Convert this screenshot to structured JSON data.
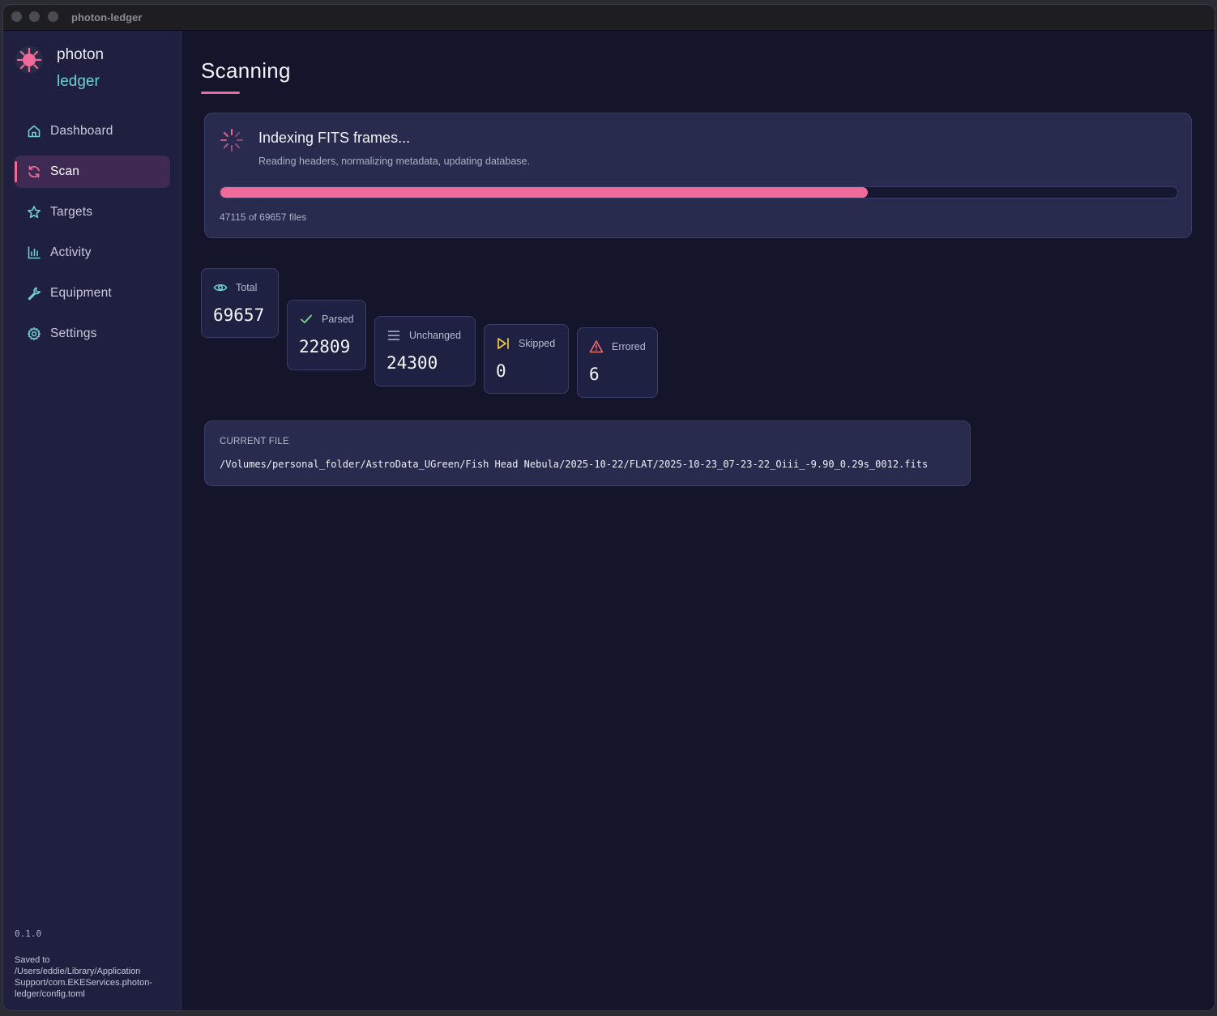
{
  "window": {
    "title": "photon-ledger"
  },
  "brand": {
    "line1": "photon",
    "line2": "ledger"
  },
  "sidebar": {
    "items": [
      {
        "label": "Dashboard",
        "icon": "home-icon",
        "active": false
      },
      {
        "label": "Scan",
        "icon": "refresh-icon",
        "active": true
      },
      {
        "label": "Targets",
        "icon": "star-icon",
        "active": false
      },
      {
        "label": "Activity",
        "icon": "bar-chart-icon",
        "active": false
      },
      {
        "label": "Equipment",
        "icon": "wrench-icon",
        "active": false
      },
      {
        "label": "Settings",
        "icon": "gear-icon",
        "active": false
      }
    ],
    "version": "0.1.0",
    "saved_to": "Saved to /Users/eddie/Library/Application Support/com.EKEServices.photon-ledger/config.toml"
  },
  "page": {
    "title": "Scanning"
  },
  "scan": {
    "title": "Indexing FITS frames...",
    "subtitle": "Reading headers, normalizing metadata, updating database.",
    "progress_text": "47115 of 69657 files",
    "progress_fraction": 0.6764
  },
  "stats": [
    {
      "label": "Total",
      "value": "69657",
      "icon": "eye-icon",
      "color": "#6fd0cf"
    },
    {
      "label": "Parsed",
      "value": "22809",
      "icon": "check-icon",
      "color": "#7fd98a"
    },
    {
      "label": "Unchanged",
      "value": "24300",
      "icon": "lines-icon",
      "color": "#b8bad0"
    },
    {
      "label": "Skipped",
      "value": "0",
      "icon": "skip-icon",
      "color": "#f2c94c"
    },
    {
      "label": "Errored",
      "value": "6",
      "icon": "warning-icon",
      "color": "#f06b6b"
    }
  ],
  "current_file": {
    "label": "CURRENT FILE",
    "path": "/Volumes/personal_folder/AstroData_UGreen/Fish Head Nebula/2025-10-22/FLAT/2025-10-23_07-23-22_Oiii_-9.90_0.29s_0012.fits"
  },
  "colors": {
    "accent": "#f06b9a",
    "teal": "#6fd0cf",
    "background": "#14152a",
    "sidebar": "#1f2040"
  }
}
